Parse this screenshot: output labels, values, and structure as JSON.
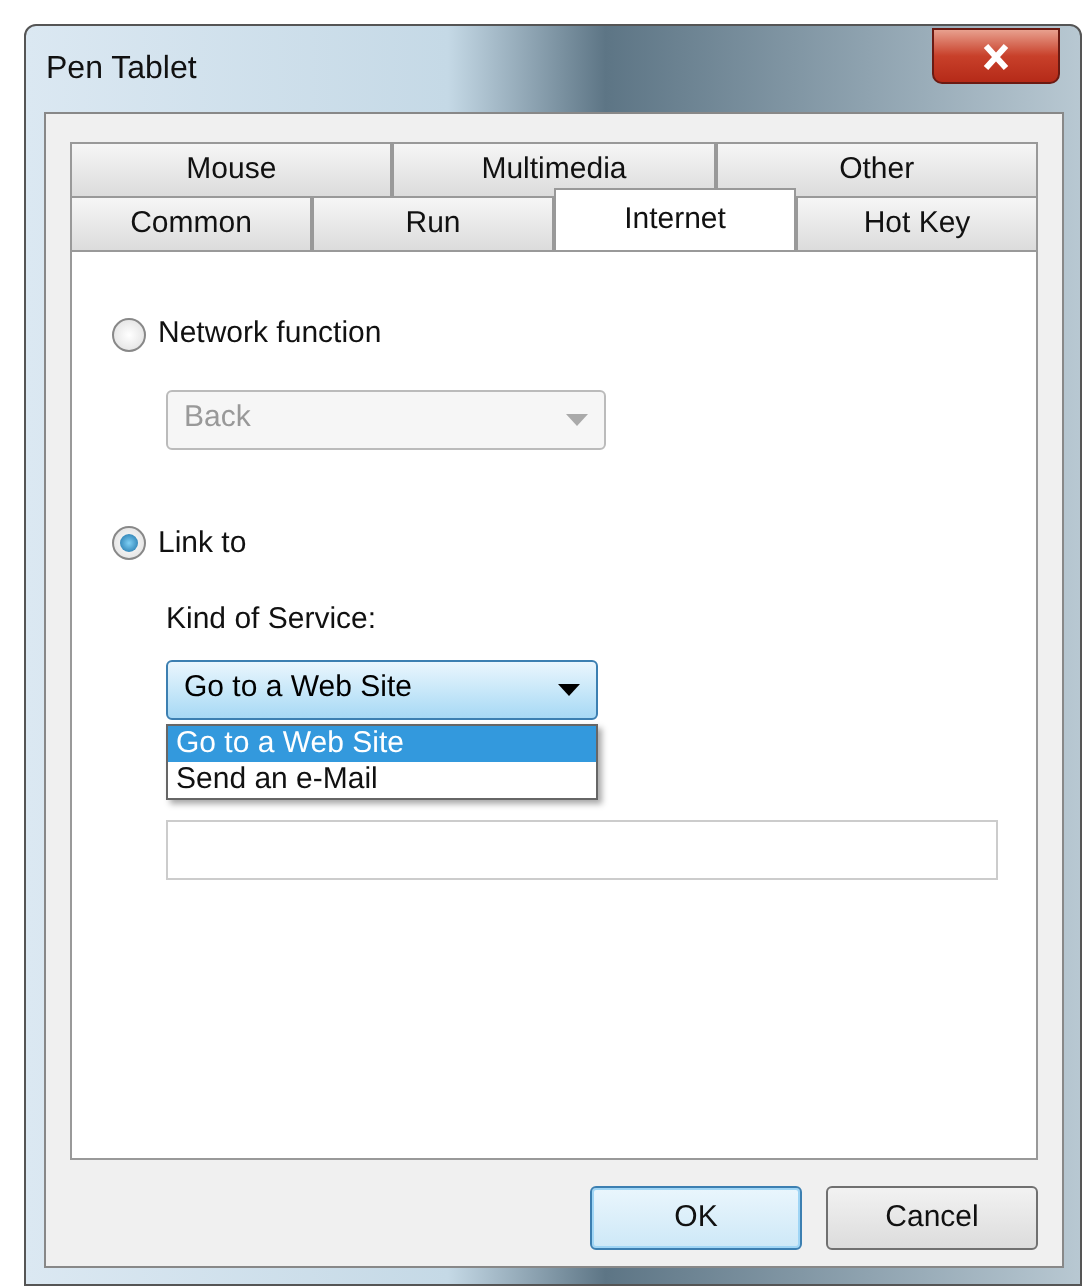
{
  "window": {
    "title": "Pen Tablet"
  },
  "tab_rows": [
    [
      {
        "label": "Mouse",
        "selected": false
      },
      {
        "label": "Multimedia",
        "selected": false
      },
      {
        "label": "Other",
        "selected": false
      }
    ],
    [
      {
        "label": "Common",
        "selected": false
      },
      {
        "label": "Run",
        "selected": false
      },
      {
        "label": "Internet",
        "selected": true
      },
      {
        "label": "Hot Key",
        "selected": false
      }
    ]
  ],
  "network_function": {
    "label": "Network function",
    "selected": false,
    "dropdown": {
      "value": "Back",
      "disabled": true
    }
  },
  "link_to": {
    "label": "Link to",
    "selected": true,
    "service_label": "Kind of Service:",
    "service_dropdown": {
      "value": "Go to a Web Site",
      "expanded": true,
      "options": [
        {
          "label": "Go to a Web Site",
          "selected": true
        },
        {
          "label": "Send an e-Mail",
          "selected": false
        }
      ]
    }
  },
  "buttons": [
    {
      "label": "OK",
      "default": true
    },
    {
      "label": "Cancel",
      "default": false
    }
  ]
}
